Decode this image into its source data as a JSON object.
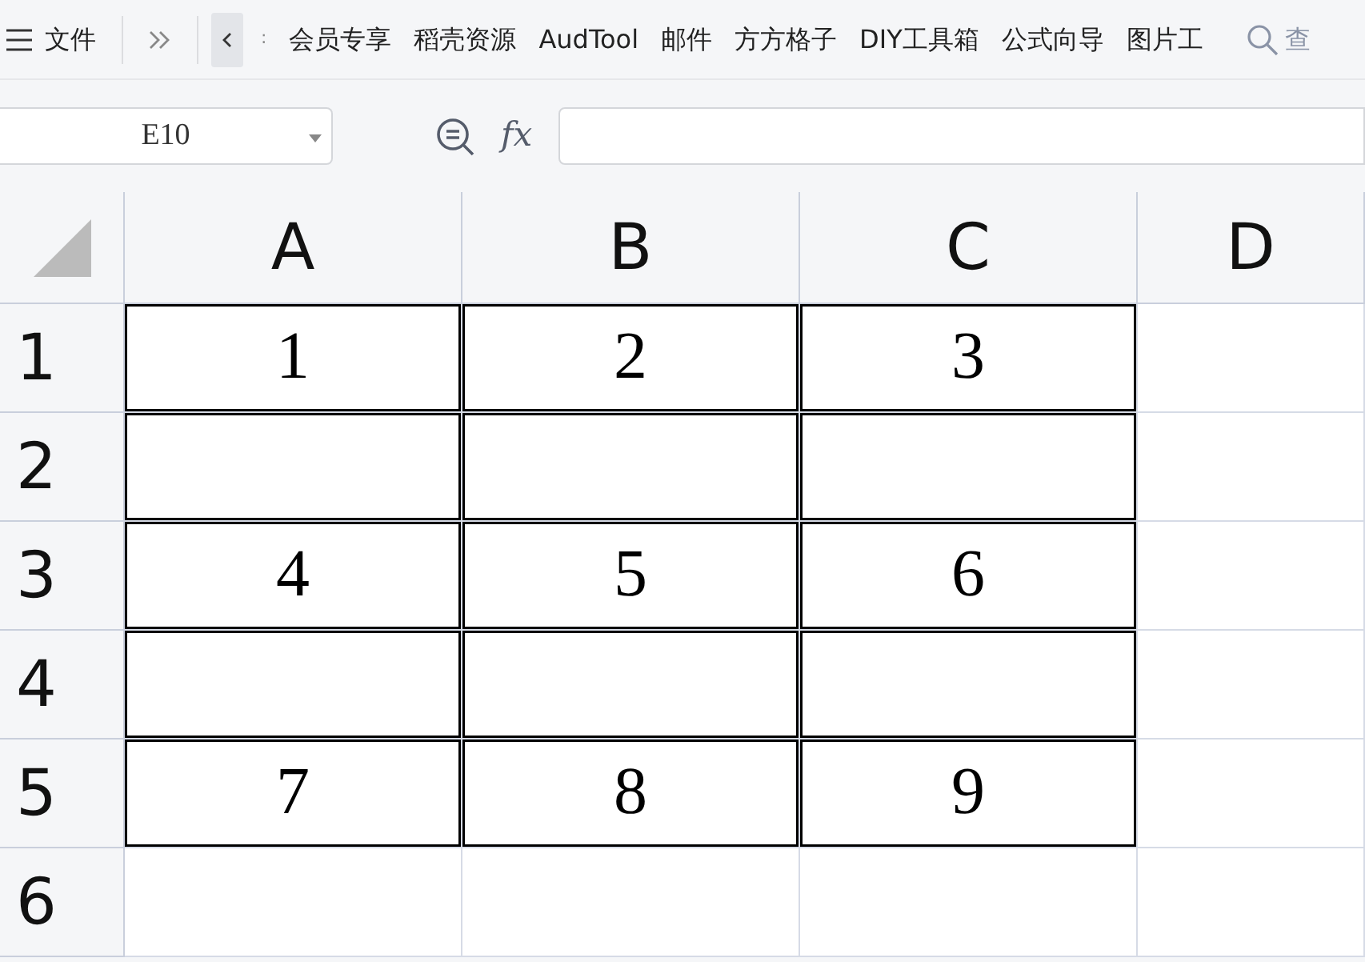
{
  "toolbar": {
    "menu_label": "文件",
    "tabs": [
      ":",
      "会员专享",
      "稻壳资源",
      "AudTool",
      "邮件",
      "方方格子",
      "DIY工具箱",
      "公式向导",
      "图片工"
    ],
    "search_label": "查"
  },
  "formula_bar": {
    "name_box": "E10",
    "fx_label": "fx"
  },
  "sheet": {
    "columns": [
      "A",
      "B",
      "C",
      "D"
    ],
    "rows": [
      {
        "header": "1",
        "cells": [
          {
            "text": "1",
            "bordered": true
          },
          {
            "text": "2",
            "bordered": true
          },
          {
            "text": "3",
            "bordered": true
          },
          {
            "bordered": false
          }
        ]
      },
      {
        "header": "2",
        "cells": [
          {
            "bordered": true
          },
          {
            "bordered": true
          },
          {
            "bordered": true
          },
          {
            "bordered": false
          }
        ]
      },
      {
        "header": "3",
        "cells": [
          {
            "text": "4",
            "bordered": true
          },
          {
            "text": "5",
            "bordered": true
          },
          {
            "text": "6",
            "bordered": true
          },
          {
            "bordered": false
          }
        ]
      },
      {
        "header": "4",
        "cells": [
          {
            "bordered": true
          },
          {
            "bordered": true
          },
          {
            "bordered": true
          },
          {
            "bordered": false
          }
        ]
      },
      {
        "header": "5",
        "cells": [
          {
            "text": "7",
            "bordered": true
          },
          {
            "text": "8",
            "bordered": true
          },
          {
            "text": "9",
            "bordered": true
          },
          {
            "bordered": false
          }
        ]
      },
      {
        "header": "6",
        "cells": [
          {
            "bordered": false
          },
          {
            "bordered": false
          },
          {
            "bordered": false
          },
          {
            "bordered": false
          }
        ]
      }
    ]
  }
}
